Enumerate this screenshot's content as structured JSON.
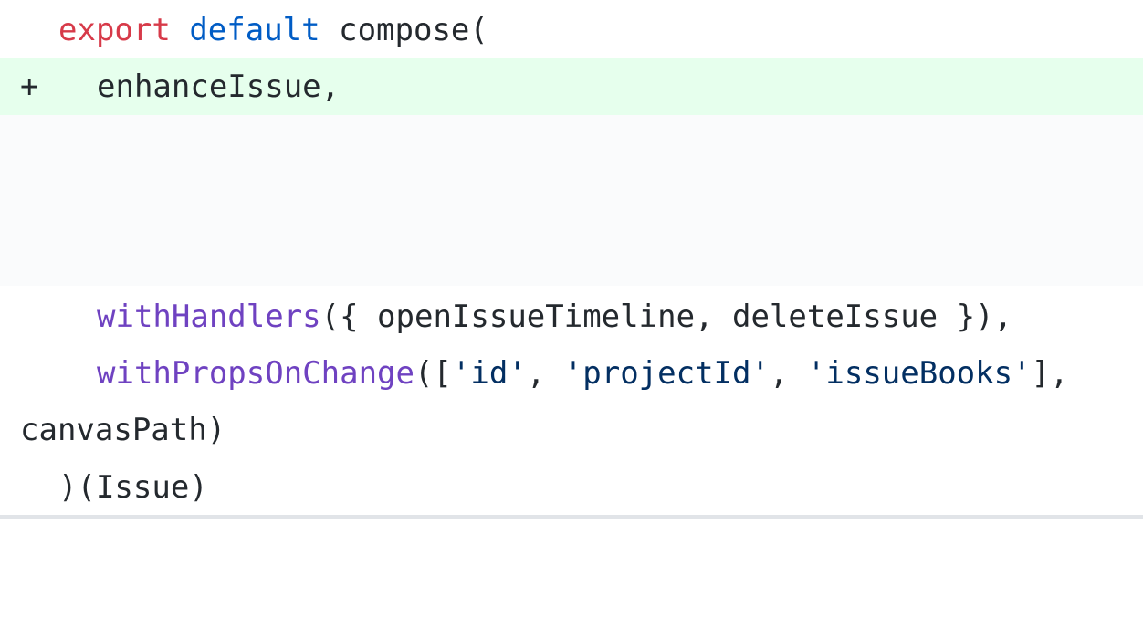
{
  "diff": {
    "line1": {
      "export_kw": "export",
      "default_kw": "default",
      "rest": "compose("
    },
    "line2": {
      "marker": "+",
      "text": "enhanceIssue,"
    },
    "line3": {
      "fn": "withHandlers",
      "rest": "({ openIssueTimeline, deleteIssue }),"
    },
    "line4": {
      "fn": "withPropsOnChange",
      "open": "([",
      "str1": "'id'",
      "sep1": ", ",
      "str2": "'projectId'",
      "sep2": ", ",
      "str3": "'issueBooks'",
      "close": "],"
    },
    "line5": {
      "text": "canvasPath)"
    },
    "line6": {
      "text": ")(Issue)"
    }
  },
  "colors": {
    "added_bg": "#e6ffed",
    "expanded_bg": "#fafbfc",
    "keyword_red": "#d73a49",
    "keyword_blue": "#005cc5",
    "function_purple": "#6f42c1",
    "string_navy": "#032f62"
  }
}
